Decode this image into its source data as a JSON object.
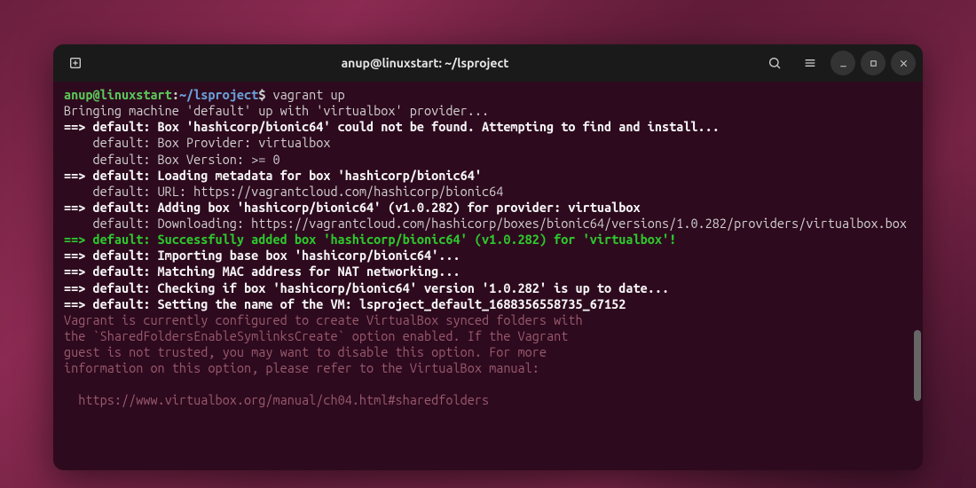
{
  "window": {
    "title": "anup@linuxstart: ~/lsproject"
  },
  "prompt": {
    "user_host": "anup@linuxstart",
    "separator": ":",
    "path": "~/lsproject",
    "symbol": "$",
    "command": "vagrant up"
  },
  "output": {
    "l1": "Bringing machine 'default' up with 'virtualbox' provider...",
    "l2": "==> default: Box 'hashicorp/bionic64' could not be found. Attempting to find and install...",
    "l3": "    default: Box Provider: virtualbox",
    "l4": "    default: Box Version: >= 0",
    "l5": "==> default: Loading metadata for box 'hashicorp/bionic64'",
    "l6": "    default: URL: https://vagrantcloud.com/hashicorp/bionic64",
    "l7": "==> default: Adding box 'hashicorp/bionic64' (v1.0.282) for provider: virtualbox",
    "l8": "    default: Downloading: https://vagrantcloud.com/hashicorp/boxes/bionic64/versions/1.0.282/providers/virtualbox.box",
    "l9": "==> default: Successfully added box 'hashicorp/bionic64' (v1.0.282) for 'virtualbox'!",
    "l10": "==> default: Importing base box 'hashicorp/bionic64'...",
    "l11": "==> default: Matching MAC address for NAT networking...",
    "l12": "==> default: Checking if box 'hashicorp/bionic64' version '1.0.282' is up to date...",
    "l13": "==> default: Setting the name of the VM: lsproject_default_1688356558735_67152",
    "w1": "Vagrant is currently configured to create VirtualBox synced folders with",
    "w2": "the `SharedFoldersEnableSymlinksCreate` option enabled. If the Vagrant",
    "w3": "guest is not trusted, you may want to disable this option. For more",
    "w4": "information on this option, please refer to the VirtualBox manual:",
    "w5": "  https://www.virtualbox.org/manual/ch04.html#sharedfolders"
  }
}
